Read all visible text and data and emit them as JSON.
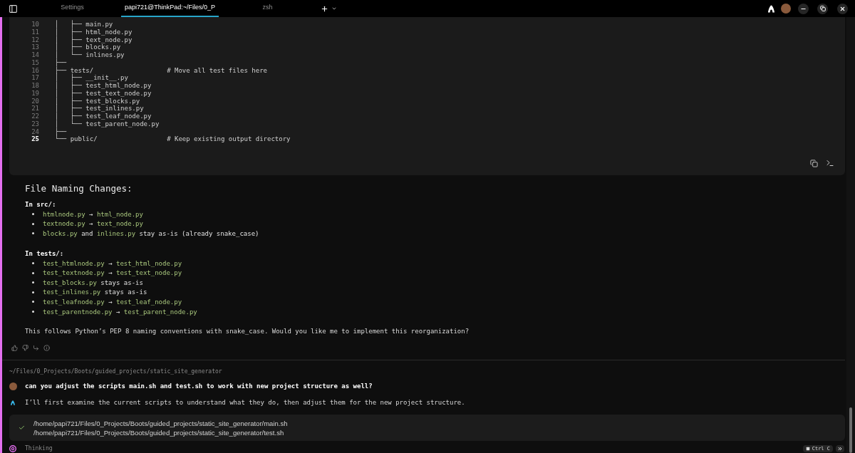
{
  "tab_bar": {
    "tabs": [
      {
        "label": "Settings",
        "selected": false
      },
      {
        "label": "papi721@ThinkPad:~/Files/0_P",
        "selected": true
      },
      {
        "label": "zsh",
        "selected": false
      }
    ]
  },
  "code_block": {
    "lines": [
      {
        "number": "10",
        "text": "│   ├── main.py",
        "current": false
      },
      {
        "number": "11",
        "text": "│   ├── html_node.py",
        "current": false
      },
      {
        "number": "12",
        "text": "│   ├── text_node.py",
        "current": false
      },
      {
        "number": "13",
        "text": "│   ├── blocks.py",
        "current": false
      },
      {
        "number": "14",
        "text": "│   └── inlines.py",
        "current": false
      },
      {
        "number": "15",
        "text": "├──",
        "current": false
      },
      {
        "number": "16",
        "text": "├── tests/                   # Move all test files here",
        "current": false
      },
      {
        "number": "17",
        "text": "│   ├── __init__.py",
        "current": false
      },
      {
        "number": "18",
        "text": "│   ├── test_html_node.py",
        "current": false
      },
      {
        "number": "19",
        "text": "│   ├── test_text_node.py",
        "current": false
      },
      {
        "number": "20",
        "text": "│   ├── test_blocks.py",
        "current": false
      },
      {
        "number": "21",
        "text": "│   ├── test_inlines.py",
        "current": false
      },
      {
        "number": "22",
        "text": "│   ├── test_leaf_node.py",
        "current": false
      },
      {
        "number": "23",
        "text": "│   └── test_parent_node.py",
        "current": false
      },
      {
        "number": "24",
        "text": "├──",
        "current": false
      },
      {
        "number": "25",
        "text": "└── public/                  # Keep existing output directory",
        "current": true
      }
    ]
  },
  "message": {
    "heading": "File Naming Changes:",
    "sections": [
      {
        "title": "In src/:",
        "items": [
          {
            "parts": [
              {
                "kind": "code",
                "text": "htmlnode.py"
              },
              {
                "kind": "text",
                "text": "→"
              },
              {
                "kind": "code",
                "text": "html_node.py"
              }
            ]
          },
          {
            "parts": [
              {
                "kind": "code",
                "text": "textnode.py"
              },
              {
                "kind": "text",
                "text": "→"
              },
              {
                "kind": "code",
                "text": "text_node.py"
              }
            ]
          },
          {
            "parts": [
              {
                "kind": "code",
                "text": "blocks.py"
              },
              {
                "kind": "text",
                "text": "and"
              },
              {
                "kind": "code",
                "text": "inlines.py"
              },
              {
                "kind": "text",
                "text": "stay as-is (already snake_case)"
              }
            ]
          }
        ]
      },
      {
        "title": "In tests/:",
        "items": [
          {
            "parts": [
              {
                "kind": "code",
                "text": "test_htmlnode.py"
              },
              {
                "kind": "text",
                "text": "→"
              },
              {
                "kind": "code",
                "text": "test_html_node.py"
              }
            ]
          },
          {
            "parts": [
              {
                "kind": "code",
                "text": "test_textnode.py"
              },
              {
                "kind": "text",
                "text": "→"
              },
              {
                "kind": "code",
                "text": "test_text_node.py"
              }
            ]
          },
          {
            "parts": [
              {
                "kind": "code",
                "text": "test_blocks.py"
              },
              {
                "kind": "text",
                "text": "stays as-is"
              }
            ]
          },
          {
            "parts": [
              {
                "kind": "code",
                "text": "test_inlines.py"
              },
              {
                "kind": "text",
                "text": "stays as-is"
              }
            ]
          },
          {
            "parts": [
              {
                "kind": "code",
                "text": "test_leafnode.py"
              },
              {
                "kind": "text",
                "text": "→"
              },
              {
                "kind": "code",
                "text": "test_leaf_node.py"
              }
            ]
          },
          {
            "parts": [
              {
                "kind": "code",
                "text": "test_parentnode.py"
              },
              {
                "kind": "text",
                "text": "→"
              },
              {
                "kind": "code",
                "text": "test_parent_node.py"
              }
            ]
          }
        ]
      }
    ],
    "paragraph": "This follows Python’s PEP 8 naming conventions with snake_case. Would you like me to implement this reorganization?"
  },
  "cwd": "~/Files/0_Projects/Boots/guided_projects/static_site_generator",
  "user_prompt": "can you adjust the scripts main.sh and test.sh to work with new project structure as well?",
  "agent_reply": "I’ll first examine the current scripts to understand what they do, then adjust them for the new project structure.",
  "tool_result": {
    "succeeded": true,
    "paths": [
      "/home/papi721/Files/0_Projects/Boots/guided_projects/static_site_generator/main.sh",
      "/home/papi721/Files/0_Projects/Boots/guided_projects/static_site_generator/test.sh"
    ]
  },
  "status": {
    "label": "Thinking"
  },
  "stop_button": {
    "label": "Ctrl C"
  }
}
